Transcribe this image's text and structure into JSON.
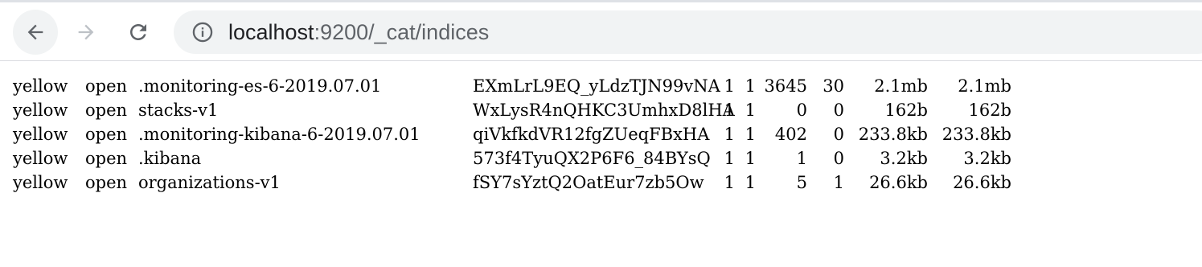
{
  "browser": {
    "url_host": "localhost",
    "url_path": ":9200/_cat/indices",
    "icons": {
      "back": "arrow-left-icon",
      "forward": "arrow-right-icon",
      "reload": "reload-icon",
      "site_info": "info-circle-icon"
    },
    "colors": {
      "omnibox_bg": "#f1f3f4",
      "icon_active": "#5f6368",
      "icon_disabled": "#bdc1c6"
    }
  },
  "indices": [
    {
      "health": "yellow",
      "status": "open",
      "index": ".monitoring-es-6-2019.07.01",
      "uuid": "EXmLrL9EQ_yLdzTJN99vNA",
      "pri": "1",
      "rep": "1",
      "docs_count": "3645",
      "docs_deleted": "30",
      "store_size": "2.1mb",
      "pri_store_size": "2.1mb"
    },
    {
      "health": "yellow",
      "status": "open",
      "index": "stacks-v1",
      "uuid": "WxLysR4nQHKC3UmhxD8lHA",
      "pri": "1",
      "rep": "1",
      "docs_count": "0",
      "docs_deleted": "0",
      "store_size": "162b",
      "pri_store_size": "162b"
    },
    {
      "health": "yellow",
      "status": "open",
      "index": ".monitoring-kibana-6-2019.07.01",
      "uuid": "qiVkfkdVR12fgZUeqFBxHA",
      "pri": "1",
      "rep": "1",
      "docs_count": "402",
      "docs_deleted": "0",
      "store_size": "233.8kb",
      "pri_store_size": "233.8kb"
    },
    {
      "health": "yellow",
      "status": "open",
      "index": ".kibana",
      "uuid": "573f4TyuQX2P6F6_84BYsQ",
      "pri": "1",
      "rep": "1",
      "docs_count": "1",
      "docs_deleted": "0",
      "store_size": "3.2kb",
      "pri_store_size": "3.2kb"
    },
    {
      "health": "yellow",
      "status": "open",
      "index": "organizations-v1",
      "uuid": "fSY7sYztQ2OatEur7zb5Ow",
      "pri": "1",
      "rep": "1",
      "docs_count": "5",
      "docs_deleted": "1",
      "store_size": "26.6kb",
      "pri_store_size": "26.6kb"
    }
  ]
}
